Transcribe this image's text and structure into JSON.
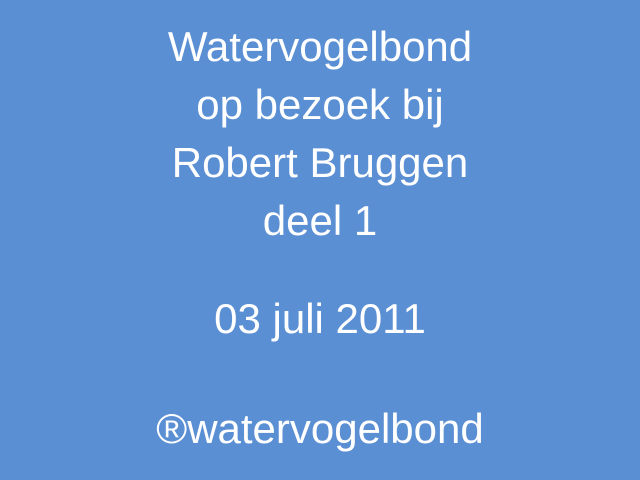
{
  "slide": {
    "background_color": "#5a8fd4",
    "text_color": "#ffffff",
    "title_lines": [
      "Watervogelbond",
      "op bezoek bij",
      "Robert Bruggen",
      "deel 1"
    ],
    "date": "03 juli 2011",
    "copyright": "®watervogelbond"
  }
}
